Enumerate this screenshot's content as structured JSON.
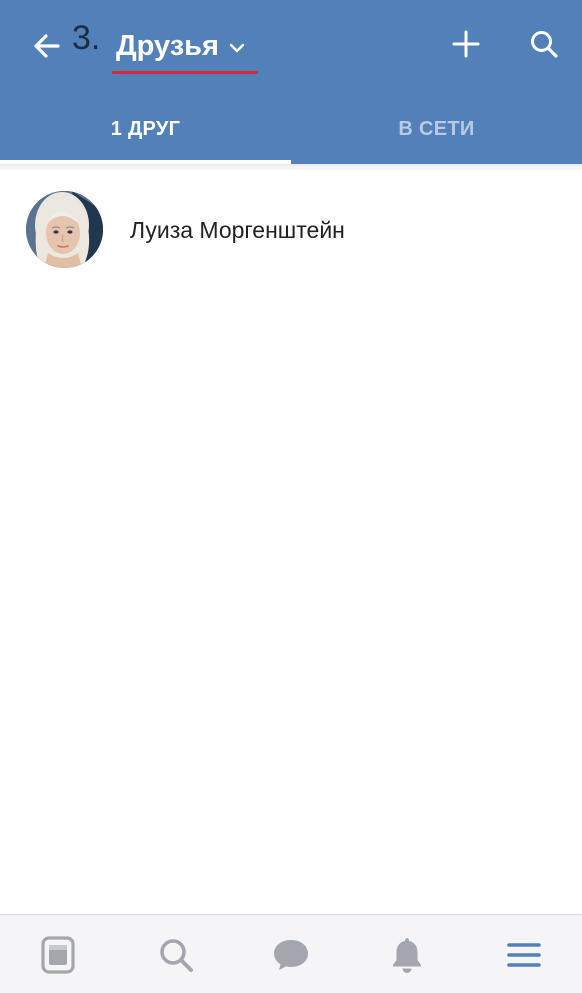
{
  "header": {
    "annotation_number": "3.",
    "title": "Друзья",
    "back_icon": "arrow-left-icon",
    "chevron_icon": "chevron-down-icon",
    "add_icon": "plus-icon",
    "search_icon": "search-icon",
    "background_color": "#5181b8",
    "underline_color": "#d9263f"
  },
  "tabs": [
    {
      "label": "1 ДРУГ",
      "active": true
    },
    {
      "label": "В СЕТИ",
      "active": false
    }
  ],
  "friends": [
    {
      "name": "Луиза Моргенштейн",
      "avatar_icon": "user-photo-avatar"
    }
  ],
  "bottom_nav": {
    "items": [
      {
        "icon": "news-icon",
        "active": false
      },
      {
        "icon": "search-icon",
        "active": false
      },
      {
        "icon": "messages-icon",
        "active": false
      },
      {
        "icon": "notifications-bell-icon",
        "active": false
      },
      {
        "icon": "menu-icon",
        "active": true
      }
    ],
    "active_color": "#5181b8",
    "inactive_color": "#a3a7ad"
  }
}
